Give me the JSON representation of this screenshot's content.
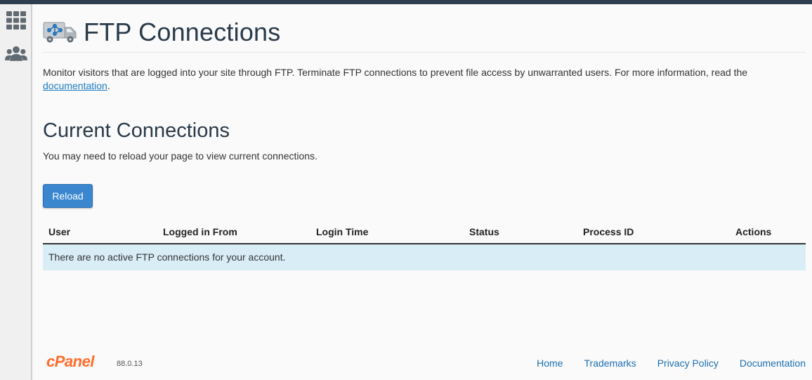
{
  "sidebar": {
    "items": [
      {
        "icon": "apps-grid-icon"
      },
      {
        "icon": "users-icon"
      }
    ]
  },
  "header": {
    "title": "FTP Connections",
    "icon": "ftp-truck-icon"
  },
  "description": {
    "text": "Monitor visitors that are logged into your site through FTP. Terminate FTP connections to prevent file access by unwarranted users. For more information, read the ",
    "link_label": "documentation",
    "suffix": "."
  },
  "connections": {
    "title": "Current Connections",
    "subtitle": "You may need to reload your page to view current connections.",
    "reload_label": "Reload",
    "columns": [
      "User",
      "Logged in From",
      "Login Time",
      "Status",
      "Process ID",
      "Actions"
    ],
    "empty_message": "There are no active FTP connections for your account."
  },
  "footer": {
    "logo": "cPanel",
    "version": "88.0.13",
    "links": [
      "Home",
      "Trademarks",
      "Privacy Policy",
      "Documentation"
    ]
  },
  "colors": {
    "accent": "#3a87d0",
    "link": "#1b7bbf",
    "empty_row_bg": "#d9edf7",
    "brand": "#ff6c2c",
    "topbar": "#2d3e50"
  }
}
